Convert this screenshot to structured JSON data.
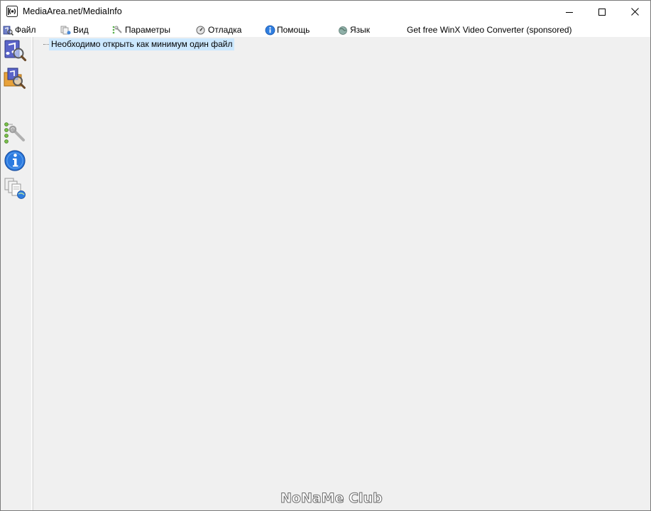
{
  "window": {
    "title": "MediaArea.net/MediaInfo",
    "app_icon": "mediainfo-logo-icon",
    "controls": [
      "minimize-icon",
      "maximize-icon",
      "close-icon"
    ]
  },
  "menu": {
    "items": [
      {
        "label": "Файл",
        "icon": "file-open-icon"
      },
      {
        "label": "Вид",
        "icon": "view-icon"
      },
      {
        "label": "Параметры",
        "icon": "options-icon"
      },
      {
        "label": "Отладка",
        "icon": "debug-icon"
      },
      {
        "label": "Помощь",
        "icon": "help-icon"
      },
      {
        "label": "Язык",
        "icon": "language-icon"
      },
      {
        "label": "Get free WinX Video Converter (sponsored)",
        "icon": ""
      }
    ]
  },
  "toolbar": {
    "buttons": [
      {
        "icon": "open-file-icon"
      },
      {
        "icon": "open-folder-icon"
      },
      {
        "icon": "preferences-icon"
      },
      {
        "icon": "about-icon"
      },
      {
        "icon": "export-icon"
      }
    ]
  },
  "content": {
    "tree_message": "Необходимо открыть как минимум один файл"
  },
  "watermark": {
    "text": "NoNaMe Club"
  },
  "colors": {
    "selection": "#cce8ff",
    "background": "#f0f0f0",
    "titlebar": "#ffffff"
  }
}
